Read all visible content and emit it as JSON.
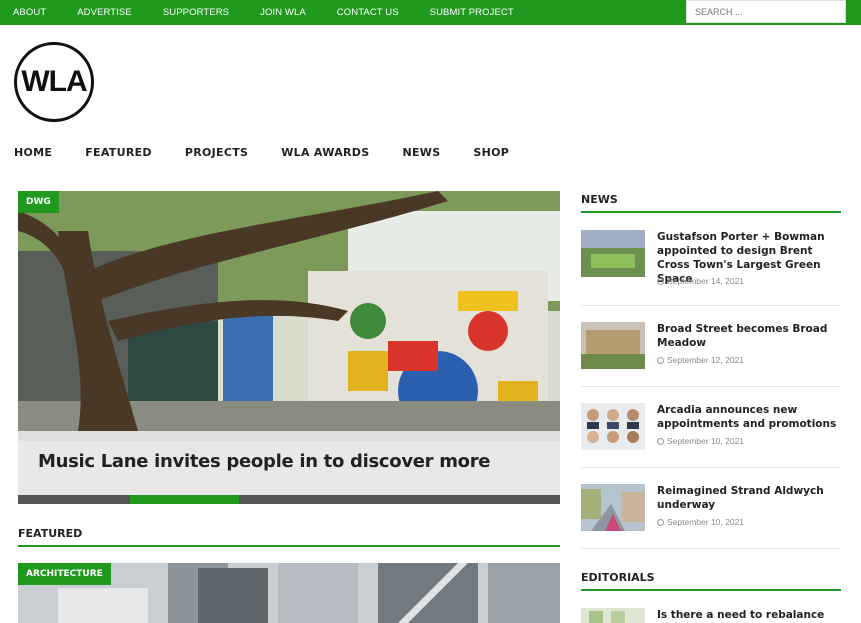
{
  "topnav": [
    "ABOUT",
    "ADVERTISE",
    "SUPPORTERS",
    "JOIN WLA",
    "CONTACT US",
    "SUBMIT PROJECT"
  ],
  "search": {
    "placeholder": "SEARCH ..."
  },
  "logo": {
    "text": "WLA"
  },
  "mainnav": [
    "HOME",
    "FEATURED",
    "PROJECTS",
    "WLA AWARDS",
    "NEWS",
    "SHOP"
  ],
  "hero": {
    "badge": "DWG",
    "title": "Music Lane invites people in to discover more",
    "slide_progress": {
      "slide": 2,
      "total": 5
    }
  },
  "featured": {
    "title": "FEATURED",
    "badge": "ARCHITECTURE"
  },
  "sidebar": {
    "news_title": "NEWS",
    "news": [
      {
        "title": "Gustafson Porter + Bowman appointed to design Brent Cross Town's Largest Green Space",
        "date": "September 14, 2021"
      },
      {
        "title": "Broad Street becomes Broad Meadow",
        "date": "September 12, 2021"
      },
      {
        "title": "Arcadia announces new appointments and promotions",
        "date": "September 10, 2021"
      },
      {
        "title": "Reimagined Strand Aldwych underway",
        "date": "September 10, 2021"
      }
    ],
    "editorials_title": "EDITORIALS",
    "editorials": [
      {
        "title": "Is there a need to rebalance"
      }
    ]
  },
  "colors": {
    "accent": "#1f9a1f"
  }
}
